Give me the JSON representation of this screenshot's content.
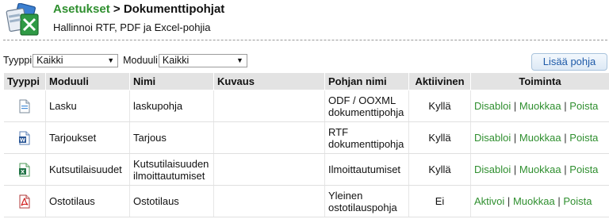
{
  "header": {
    "breadcrumb_home": "Asetukset",
    "breadcrumb_separator": ">",
    "breadcrumb_current": "Dokumenttipohjat",
    "subtitle": "Hallinnoi RTF, PDF ja Excel-pohjia"
  },
  "filters": {
    "type_label": "Tyyppi",
    "type_value": "Kaikki",
    "module_label": "Moduuli",
    "module_value": "Kaikki"
  },
  "actions": {
    "add_template_label": "Lisää pohja"
  },
  "table": {
    "columns": [
      "Tyyppi",
      "Moduuli",
      "Nimi",
      "Kuvaus",
      "Pohjan nimi",
      "Aktiivinen",
      "Toiminta"
    ],
    "separator": "|",
    "rows": [
      {
        "type_icon": "odf-document-icon",
        "module": "Lasku",
        "name": "laskupohja",
        "description": "",
        "template_name": "ODF / OOXML dokumenttipohja",
        "active": "Kyllä",
        "toggle_action": "Disabloi",
        "edit_action": "Muokkaa",
        "delete_action": "Poista"
      },
      {
        "type_icon": "word-document-icon",
        "module": "Tarjoukset",
        "name": "Tarjous",
        "description": "",
        "template_name": "RTF dokumenttipohja",
        "active": "Kyllä",
        "toggle_action": "Disabloi",
        "edit_action": "Muokkaa",
        "delete_action": "Poista"
      },
      {
        "type_icon": "excel-document-icon",
        "module": "Kutsutilaisuudet",
        "name": "Kutsutilaisuuden ilmoittautumiset",
        "description": "",
        "template_name": "Ilmoittautumiset",
        "active": "Kyllä",
        "toggle_action": "Disabloi",
        "edit_action": "Muokkaa",
        "delete_action": "Poista"
      },
      {
        "type_icon": "pdf-document-icon",
        "module": "Ostotilaus",
        "name": "Ostotilaus",
        "description": "",
        "template_name": "Yleinen ostotilauspohja",
        "active": "Ei",
        "toggle_action": "Aktivoi",
        "edit_action": "Muokkaa",
        "delete_action": "Poista"
      }
    ]
  },
  "colors": {
    "link_green": "#2f8f2f",
    "inactive_red": "#d21e1e",
    "header_gray": "#e3e3e3",
    "button_text_blue": "#1e5aa8"
  }
}
